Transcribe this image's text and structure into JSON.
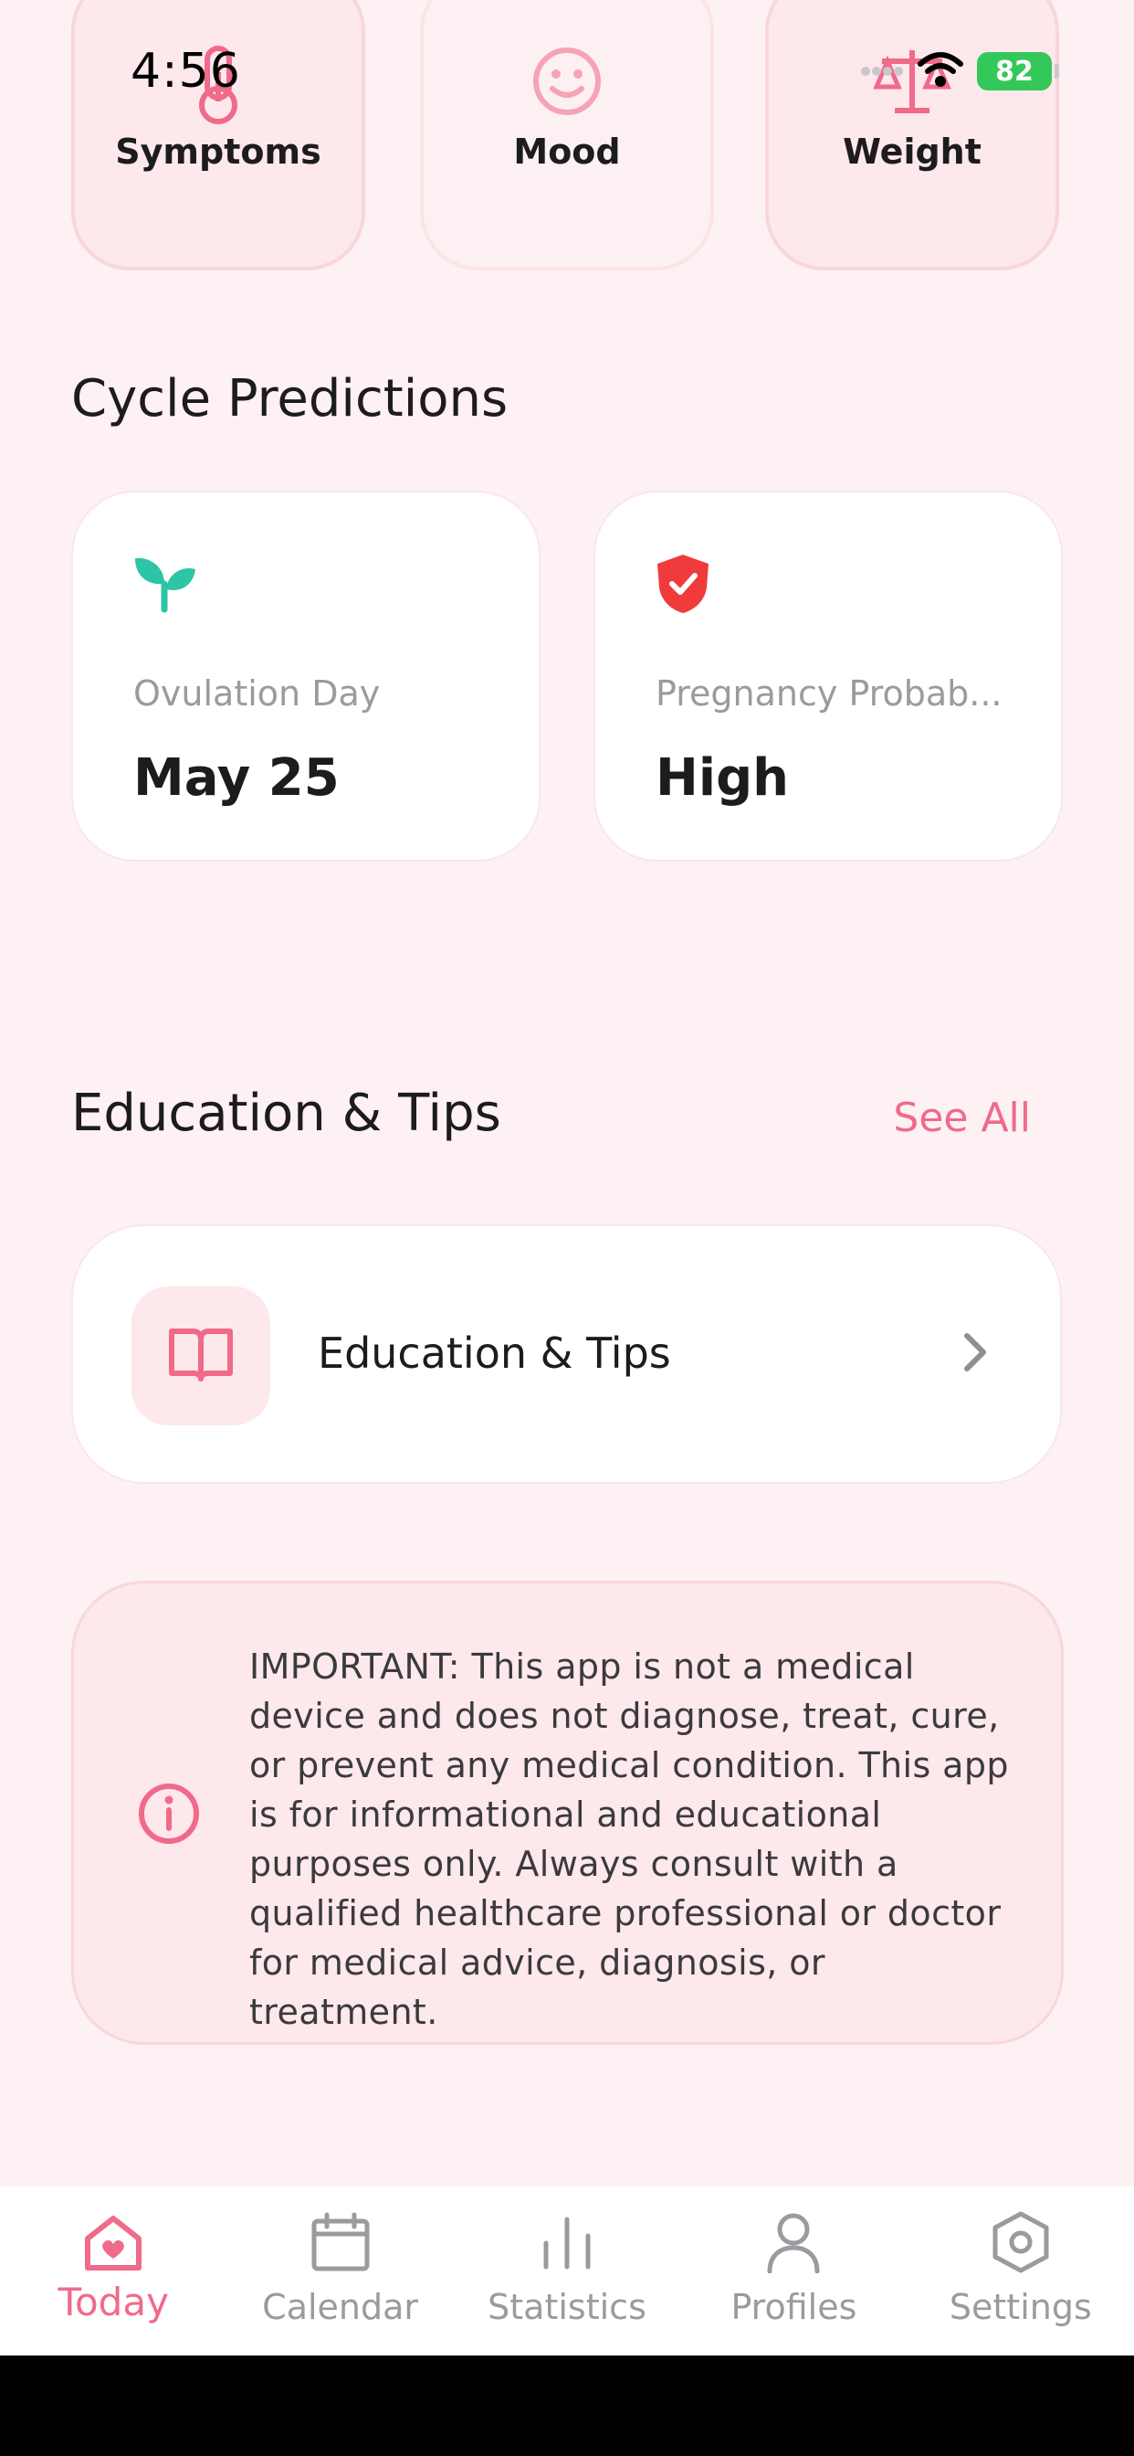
{
  "status_bar": {
    "time": "4:56",
    "battery": "82"
  },
  "quick_log": [
    {
      "label": "Symptoms",
      "icon": "thermometer-icon"
    },
    {
      "label": "Mood",
      "icon": "smiley-icon"
    },
    {
      "label": "Weight",
      "icon": "scale-icon"
    }
  ],
  "cycle_predictions": {
    "title": "Cycle Predictions",
    "cards": [
      {
        "label": "Ovulation Day",
        "value": "May 25",
        "icon": "sprout-icon",
        "icon_color": "#2ec4a6"
      },
      {
        "label": "Pregnancy Probab...",
        "value": "High",
        "icon": "shield-check-icon",
        "icon_color": "#ef3b3b"
      }
    ]
  },
  "education": {
    "title": "Education & Tips",
    "see_all": "See All",
    "card_label": "Education & Tips",
    "icon": "book-icon"
  },
  "disclaimer": {
    "text": "IMPORTANT: This app is not a medical device and does not diagnose, treat, cure, or prevent any medical condition. This app is for informational and educational purposes only. Always consult with a qualified healthcare professional or doctor for medical advice, diagnosis, or treatment.",
    "icon": "info-icon"
  },
  "tabs": [
    {
      "label": "Today",
      "icon": "home-heart-icon",
      "active": true
    },
    {
      "label": "Calendar",
      "icon": "calendar-icon",
      "active": false
    },
    {
      "label": "Statistics",
      "icon": "bar-chart-icon",
      "active": false
    },
    {
      "label": "Profiles",
      "icon": "person-icon",
      "active": false
    },
    {
      "label": "Settings",
      "icon": "gear-icon",
      "active": false
    }
  ],
  "colors": {
    "accent": "#f06a8a",
    "background": "#fdf1f3",
    "tile_bg": "#fde8ec"
  }
}
